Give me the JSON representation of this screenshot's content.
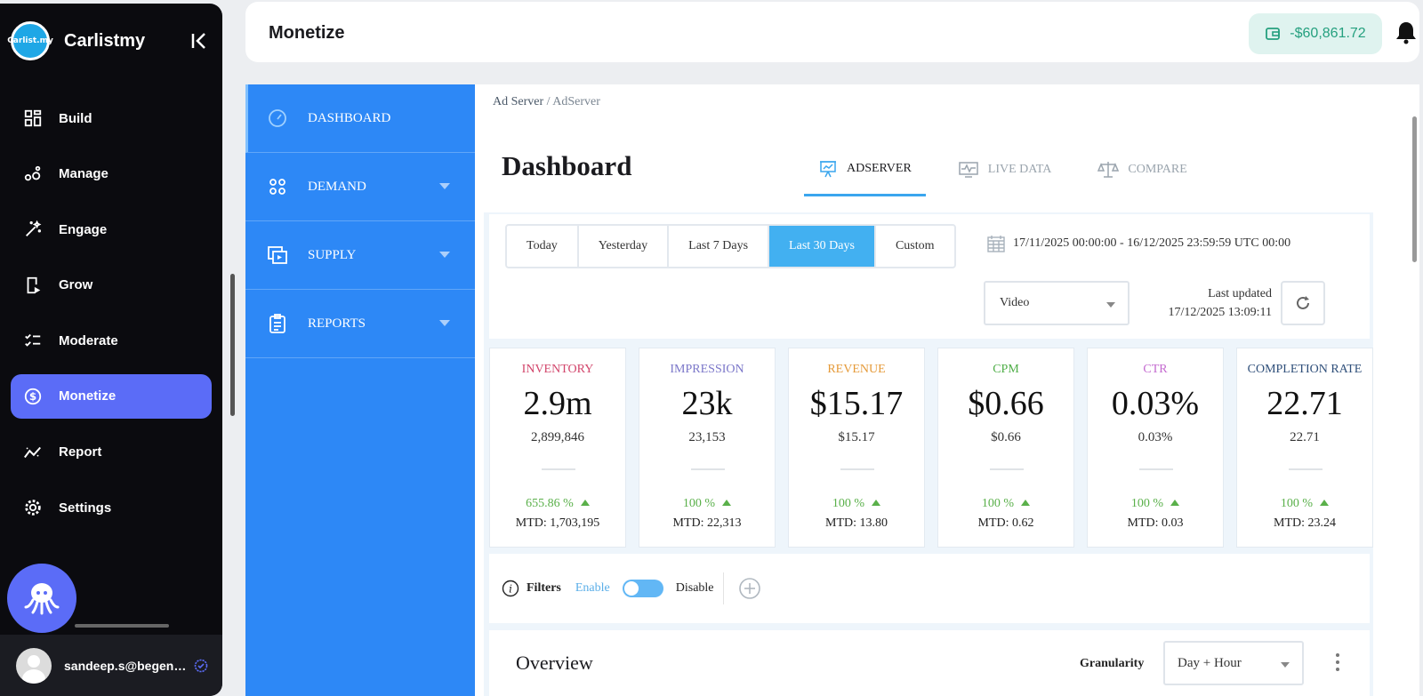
{
  "sidebar": {
    "brand_logo_text": "Carlist.my",
    "brand_name": "Carlistmy",
    "items": [
      {
        "label": "Build",
        "icon": "grid-icon"
      },
      {
        "label": "Manage",
        "icon": "manage-icon"
      },
      {
        "label": "Engage",
        "icon": "magic-wand-icon"
      },
      {
        "label": "Grow",
        "icon": "phone-play-icon"
      },
      {
        "label": "Moderate",
        "icon": "checklist-icon"
      },
      {
        "label": "Monetize",
        "icon": "dollar-circle-icon",
        "active": true
      },
      {
        "label": "Report",
        "icon": "trend-icon"
      },
      {
        "label": "Settings",
        "icon": "gear-icon"
      }
    ],
    "user_email": "sandeep.s@begenuin.com"
  },
  "header": {
    "title": "Monetize",
    "wallet_balance": "-$60,861.72"
  },
  "subnav": {
    "items": [
      {
        "label": "DASHBOARD",
        "icon": "gauge-icon",
        "active": true
      },
      {
        "label": "DEMAND",
        "icon": "four-dots-icon"
      },
      {
        "label": "SUPPLY",
        "icon": "media-icon"
      },
      {
        "label": "REPORTS",
        "icon": "clipboard-icon"
      }
    ]
  },
  "main": {
    "breadcrumb": {
      "root": "Ad Server",
      "separator": "/",
      "current": "AdServer"
    },
    "title": "Dashboard",
    "tabs": [
      {
        "label": "ADSERVER",
        "active": true
      },
      {
        "label": "LIVE DATA"
      },
      {
        "label": "COMPARE"
      }
    ],
    "date_buttons": [
      "Today",
      "Yesterday",
      "Last 7 Days",
      "Last 30 Days",
      "Custom"
    ],
    "active_date_button": "Last 30 Days",
    "date_range": "17/11/2025 00:00:00 - 16/12/2025 23:59:59 UTC 00:00",
    "type_select": "Video",
    "last_updated_label": "Last updated",
    "last_updated_value": "17/12/2025 13:09:11",
    "cards": [
      {
        "label": "INVENTORY",
        "color": "#d2456b",
        "big": "2.9m",
        "exact": "2,899,846",
        "pct": "655.86 %",
        "mtd": "MTD: 1,703,195"
      },
      {
        "label": "IMPRESSION",
        "color": "#7b77c9",
        "big": "23k",
        "exact": "23,153",
        "pct": "100 %",
        "mtd": "MTD: 22,313"
      },
      {
        "label": "REVENUE",
        "color": "#e59a39",
        "big": "$15.17",
        "exact": "$15.17",
        "pct": "100 %",
        "mtd": "MTD: 13.80"
      },
      {
        "label": "CPM",
        "color": "#4fae48",
        "big": "$0.66",
        "exact": "$0.66",
        "pct": "100 %",
        "mtd": "MTD: 0.62"
      },
      {
        "label": "CTR",
        "color": "#c46ad0",
        "big": "0.03%",
        "exact": "0.03%",
        "pct": "100 %",
        "mtd": "MTD: 0.03"
      },
      {
        "label": "COMPLETION RATE",
        "color": "#2f4f7a",
        "big": "22.71",
        "exact": "22.71",
        "pct": "100 %",
        "mtd": "MTD: 23.24"
      }
    ],
    "filters": {
      "label": "Filters",
      "enable": "Enable",
      "disable": "Disable"
    },
    "overview": {
      "title": "Overview",
      "granularity_label": "Granularity",
      "granularity_value": "Day + Hour"
    }
  },
  "colors": {
    "accent": "#5b6cf7",
    "subnav_blue": "#2d88f6",
    "active_date": "#42b0f1",
    "positive": "#5ab04a"
  }
}
